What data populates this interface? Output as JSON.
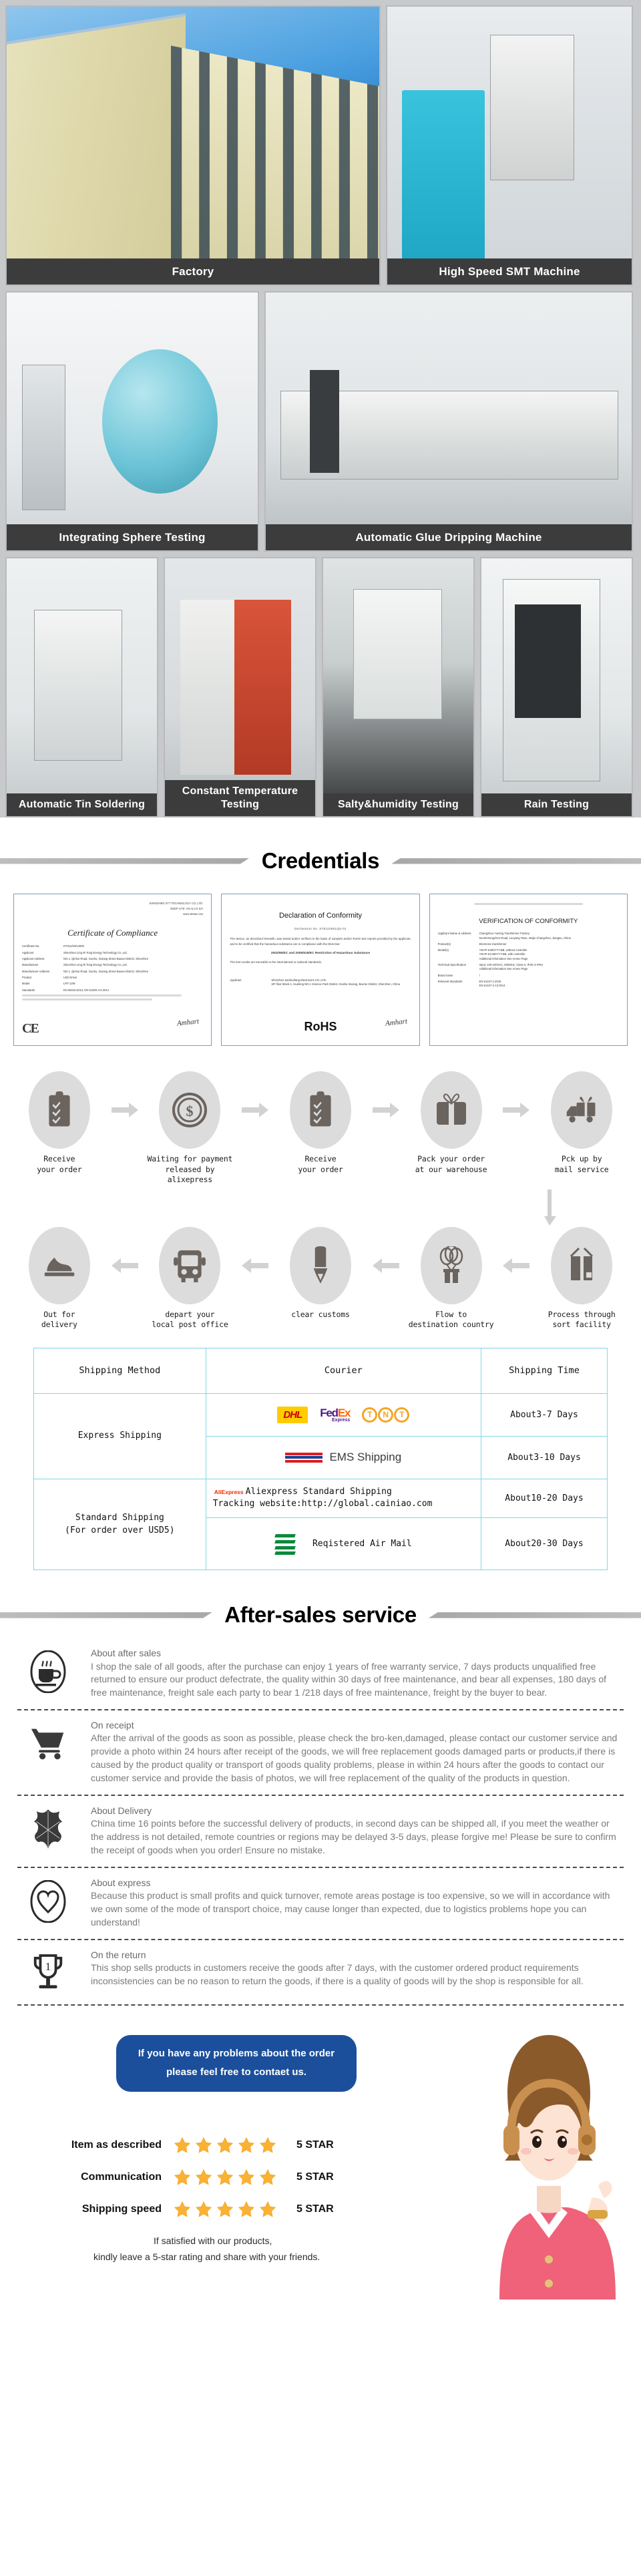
{
  "photo_grid": {
    "rows": [
      {
        "cells": [
          {
            "caption": "Factory",
            "art": "ph-factory",
            "name": "photo-factory"
          },
          {
            "caption": "High Speed SMT Machine",
            "art": "ph-smt",
            "name": "photo-smt-machine"
          }
        ]
      },
      {
        "cells": [
          {
            "caption": "Integrating Sphere Testing",
            "art": "ph-sphere",
            "name": "photo-integrating-sphere"
          },
          {
            "caption": "Automatic Glue Dripping Machine",
            "art": "ph-glue",
            "name": "photo-glue-dripping"
          }
        ]
      },
      {
        "cells": [
          {
            "caption": "Automatic Tin\nSoldering",
            "art": "ph-tin",
            "name": "photo-tin-soldering"
          },
          {
            "caption": "Constant\nTemperature\nTesting",
            "art": "ph-const",
            "name": "photo-constant-temperature"
          },
          {
            "caption": "Salty&humidity\nTesting",
            "art": "ph-salt",
            "name": "photo-salty-humidity"
          },
          {
            "caption": "Rain Testing",
            "art": "ph-rain",
            "name": "photo-rain-testing"
          }
        ]
      }
    ]
  },
  "credentials": {
    "title": "Credentials",
    "certificates": [
      {
        "header_right_1": "SHENZHEN STT TECHNOLOGY CO.,LTD.",
        "header_right_2": "DEEP LITE. AN ALCS S/A",
        "header_right_3": "www.sttstar.com",
        "title": "Certificate of Compliance",
        "rows": [
          {
            "k": "Certificate No.",
            "v": "KT012/03/14000"
          },
          {
            "k": "Applicant",
            "v": "Shenzhen Ling Ri Tong Energy Technology Co.,Ltd."
          },
          {
            "k": "Applicant Address",
            "v": "NO.1, Qinhui Road, Guohu, Xixiang Street Baoan District, Shenzhen"
          },
          {
            "k": "Manufacturer",
            "v": "Shenzhen Ling Ri Tong Energy Technology Co.,Ltd."
          },
          {
            "k": "Manufacturer Address",
            "v": "NO.1, Qinhui Road, Guohu, Xixiang Street Baoan District, Shenzhen"
          },
          {
            "k": "Product",
            "v": "LED Driver"
          },
          {
            "k": "Model",
            "v": "LRT-12W"
          },
          {
            "k": "Standards",
            "v": "EN 55015:2013, EN 61000-3-2:2014"
          }
        ],
        "mark": "CE",
        "signature": "Amhart"
      },
      {
        "title": "Declaration of Conformity",
        "subtitle": "Declaration No.  STB110801QS-01",
        "body": "The device, as described herewith, was tested and/or verified on the basis of samples and/or RoHS test reports provided by the applicant, and to be certified that the hazardous substance are in compliance with the Directive:",
        "bold": "2002/95/EC and 2005/618/EC Restriction of Hazardous Substance",
        "body2": "The test results are traceable to the international or national standards.",
        "applicant_label": "Applicant",
        "applicant_value": "Shenzhen Sanhuofang Electronics CO.,LTD.\n3/F floor Block A, Huafeng NO.1  Science Park District, Gushu Xixiang, Bao'an District, Shenzhen, China",
        "mark": "RoHS",
        "signature": "Amhart"
      },
      {
        "title": "VERIFICATION OF CONFORMITY",
        "rows": [
          {
            "k": "Applicant Name & Address",
            "v": "Changzhou Yuming Transformer Factory\nNo.88 Dongchen Road, Luoyang Town, Wujin Changzhou, Jiangsu, China"
          },
          {
            "k": "Product(s)",
            "v": "Electronic transformer"
          },
          {
            "k": "Model(s)",
            "v": "YM-IP-K300YYY-BB, without controller\nYM-IP-KC300YYY-BB, with controller\nAdditional information See Annex Page"
          },
          {
            "k": "Technical Specification",
            "v": "Input: 100-240VAC, 50/60Hz, Class II, IP20 or IP64\nAdditional information See Annex Page"
          },
          {
            "k": "Brand name",
            "v": "/"
          },
          {
            "k": "Relevant Standards",
            "v": "EN 61347-1:2015\nEN 61347-2-13:2014"
          }
        ]
      }
    ]
  },
  "process_flow": {
    "row1": [
      {
        "label": "Receive\nyour order",
        "icon": "clipboard-icon",
        "name": "flow-receive-order"
      },
      {
        "label": "Waiting for payment\nreleased by alixepress",
        "icon": "coin-dollar-icon",
        "name": "flow-waiting-payment"
      },
      {
        "label": "Receive\nyour order",
        "icon": "clipboard-icon",
        "name": "flow-receive-order-2"
      },
      {
        "label": "Pack your order\nat our warehouse",
        "icon": "gift-box-icon",
        "name": "flow-pack-order"
      },
      {
        "label": "Pck up by\nmail service",
        "icon": "delivery-truck-icon",
        "name": "flow-pickup-mail"
      }
    ],
    "row2": [
      {
        "label": "Out for\ndelivery",
        "icon": "shoe-icon",
        "name": "flow-out-for-delivery"
      },
      {
        "label": "depart your\nlocal post office",
        "icon": "bus-icon",
        "name": "flow-depart-post-office"
      },
      {
        "label": "clear customs",
        "icon": "stamp-icon",
        "name": "flow-clear-customs"
      },
      {
        "label": "Flow to\ndestination country",
        "icon": "balloon-gift-icon",
        "name": "flow-destination-country"
      },
      {
        "label": "Process through\nsort facility",
        "icon": "parcel-icon",
        "name": "flow-sort-facility"
      }
    ]
  },
  "shipping_table": {
    "headers": [
      "Shipping Method",
      "Courier",
      "Shipping Time"
    ],
    "rows": [
      {
        "method": "Express Shipping",
        "courier_type": "logos",
        "couriers": [
          "DHL",
          "FedEx",
          "TNT"
        ],
        "fedex_sub": "Express",
        "time": "About3-7 Days"
      },
      {
        "method": "",
        "courier_type": "ems",
        "ems_text": "EMS Shipping",
        "time": "About3-10 Days"
      },
      {
        "method": "Standard Shipping\n(For order over USD5)",
        "courier_type": "ali",
        "ali_badge": "AliExpress",
        "ali_line1": "Aliexpress Standard Shipping",
        "ali_line2": "Tracking website:http://global.cainiao.com",
        "time": "About10-20 Days"
      },
      {
        "method": "",
        "courier_type": "airmail",
        "airmail_text": "Reqistered Air Mail",
        "time": "About20-30 Days"
      }
    ]
  },
  "after_sales": {
    "title": "After-sales service",
    "items": [
      {
        "icon": "coffee-cup-icon",
        "name": "after-sales-about-after-sales",
        "heading": "About after sales",
        "text": " I shop the sale of all goods, after the purchase can enjoy 1 years of free warranty service, 7 days products unqualified free returned to ensure our product defectrate, the quality within 30 days of free maintenance, and bear all expenses, 180 days of free maintenance, freight sale each party to bear 1 /218 days of free maintenance, freight by the buyer to bear."
      },
      {
        "icon": "shopping-cart-icon",
        "name": "after-sales-on-receipt",
        "heading": "On receipt",
        "text": "After the arrival of the goods as soon as possible, please check the bro-ken,damaged, please contact our customer service and provide a photo within 24 hours after receipt of the goods, we will free replacement goods damaged parts or products,if there is caused by the product quality or transport of goods quality problems, please in within 24 hours after the goods to contact our customer service and provide the basis of photos, we will free replacement of the quality of the products in question."
      },
      {
        "icon": "leather-hide-icon",
        "name": "after-sales-about-delivery",
        "heading": "About Delivery",
        "text": " China time 16 points before the successful delivery of products, in second days can be shipped all, if you meet the weather or the address is not detailed, remote countries or regions may be delayed 3-5 days, please forgive me! Please be sure to confirm the receipt of goods when you order! Ensure no mistake."
      },
      {
        "icon": "heart-icon",
        "name": "after-sales-about-express",
        "heading": "About express",
        "text": "Because this product is small profits and quick turnover, remote areas postage is too expensive, so we will in accordance with we own some of the mode of transport choice, may cause longer than expected, due to logistics problems hope you can understand!"
      },
      {
        "icon": "trophy-icon",
        "name": "after-sales-on-the-return",
        "heading": "On the return",
        "text": "This shop sells products in customers receive the goods after 7 days, with the customer ordered product requirements inconsistencies can be no reason to return the goods, if there is a quality of goods will by the shop is responsible for all."
      }
    ]
  },
  "contact": {
    "button_line1": "If you have any problems about the order",
    "button_line2": "please feel free to contaet us.",
    "button_color": "#1b4f9b",
    "star_color": "#f9b233",
    "ratings": [
      {
        "label": "Item as described",
        "stars": 5,
        "value": "5 STAR",
        "name": "rating-item-as-described"
      },
      {
        "label": "Communication",
        "stars": 5,
        "value": "5 STAR",
        "name": "rating-communication"
      },
      {
        "label": "Shipping speed",
        "stars": 5,
        "value": "5 STAR",
        "name": "rating-shipping-speed"
      }
    ],
    "footer_line1": "If satisfied with our products,",
    "footer_line2": "kindly leave a 5-star rating and share with your friends."
  }
}
